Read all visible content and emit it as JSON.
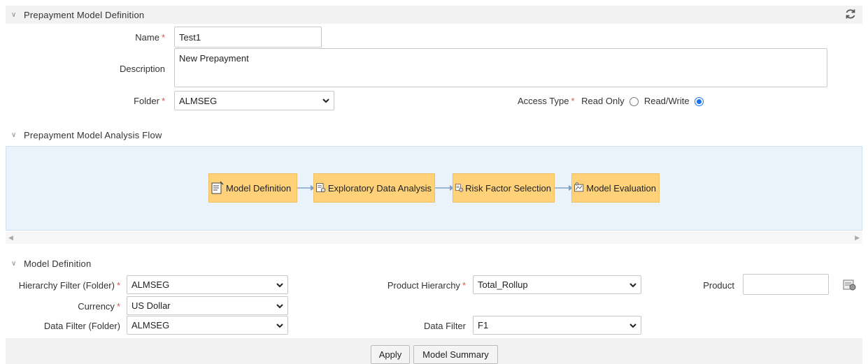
{
  "definition": {
    "header": "Prepayment Model Definition",
    "name_label": "Name",
    "name_value": "Test1",
    "description_label": "Description",
    "description_value": "New Prepayment",
    "folder_label": "Folder",
    "folder_value": "ALMSEG",
    "access_type_label": "Access Type",
    "read_only_label": "Read Only",
    "read_write_label": "Read/Write",
    "access_selected": "Read/Write"
  },
  "flow": {
    "header": "Prepayment Model Analysis Flow",
    "nodes": [
      {
        "label": "Model Definition",
        "icon": "document-edit-icon"
      },
      {
        "label": "Exploratory Data Analysis",
        "icon": "data-analysis-icon"
      },
      {
        "label": "Risk Factor Selection",
        "icon": "risk-factor-icon"
      },
      {
        "label": "Model Evaluation",
        "icon": "model-evaluation-icon"
      }
    ]
  },
  "model_definition": {
    "header": "Model Definition",
    "hierarchy_filter_label": "Hierarchy Filter (Folder)",
    "hierarchy_filter_value": "ALMSEG",
    "product_hierarchy_label": "Product Hierarchy",
    "product_hierarchy_value": "Total_Rollup",
    "product_label": "Product",
    "product_value": "",
    "currency_label": "Currency",
    "currency_value": "US Dollar",
    "data_filter_folder_label": "Data Filter (Folder)",
    "data_filter_folder_value": "ALMSEG",
    "data_filter_label": "Data Filter",
    "data_filter_value": "F1"
  },
  "buttons": {
    "apply": "Apply",
    "model_summary": "Model Summary"
  },
  "required_marker": "*"
}
